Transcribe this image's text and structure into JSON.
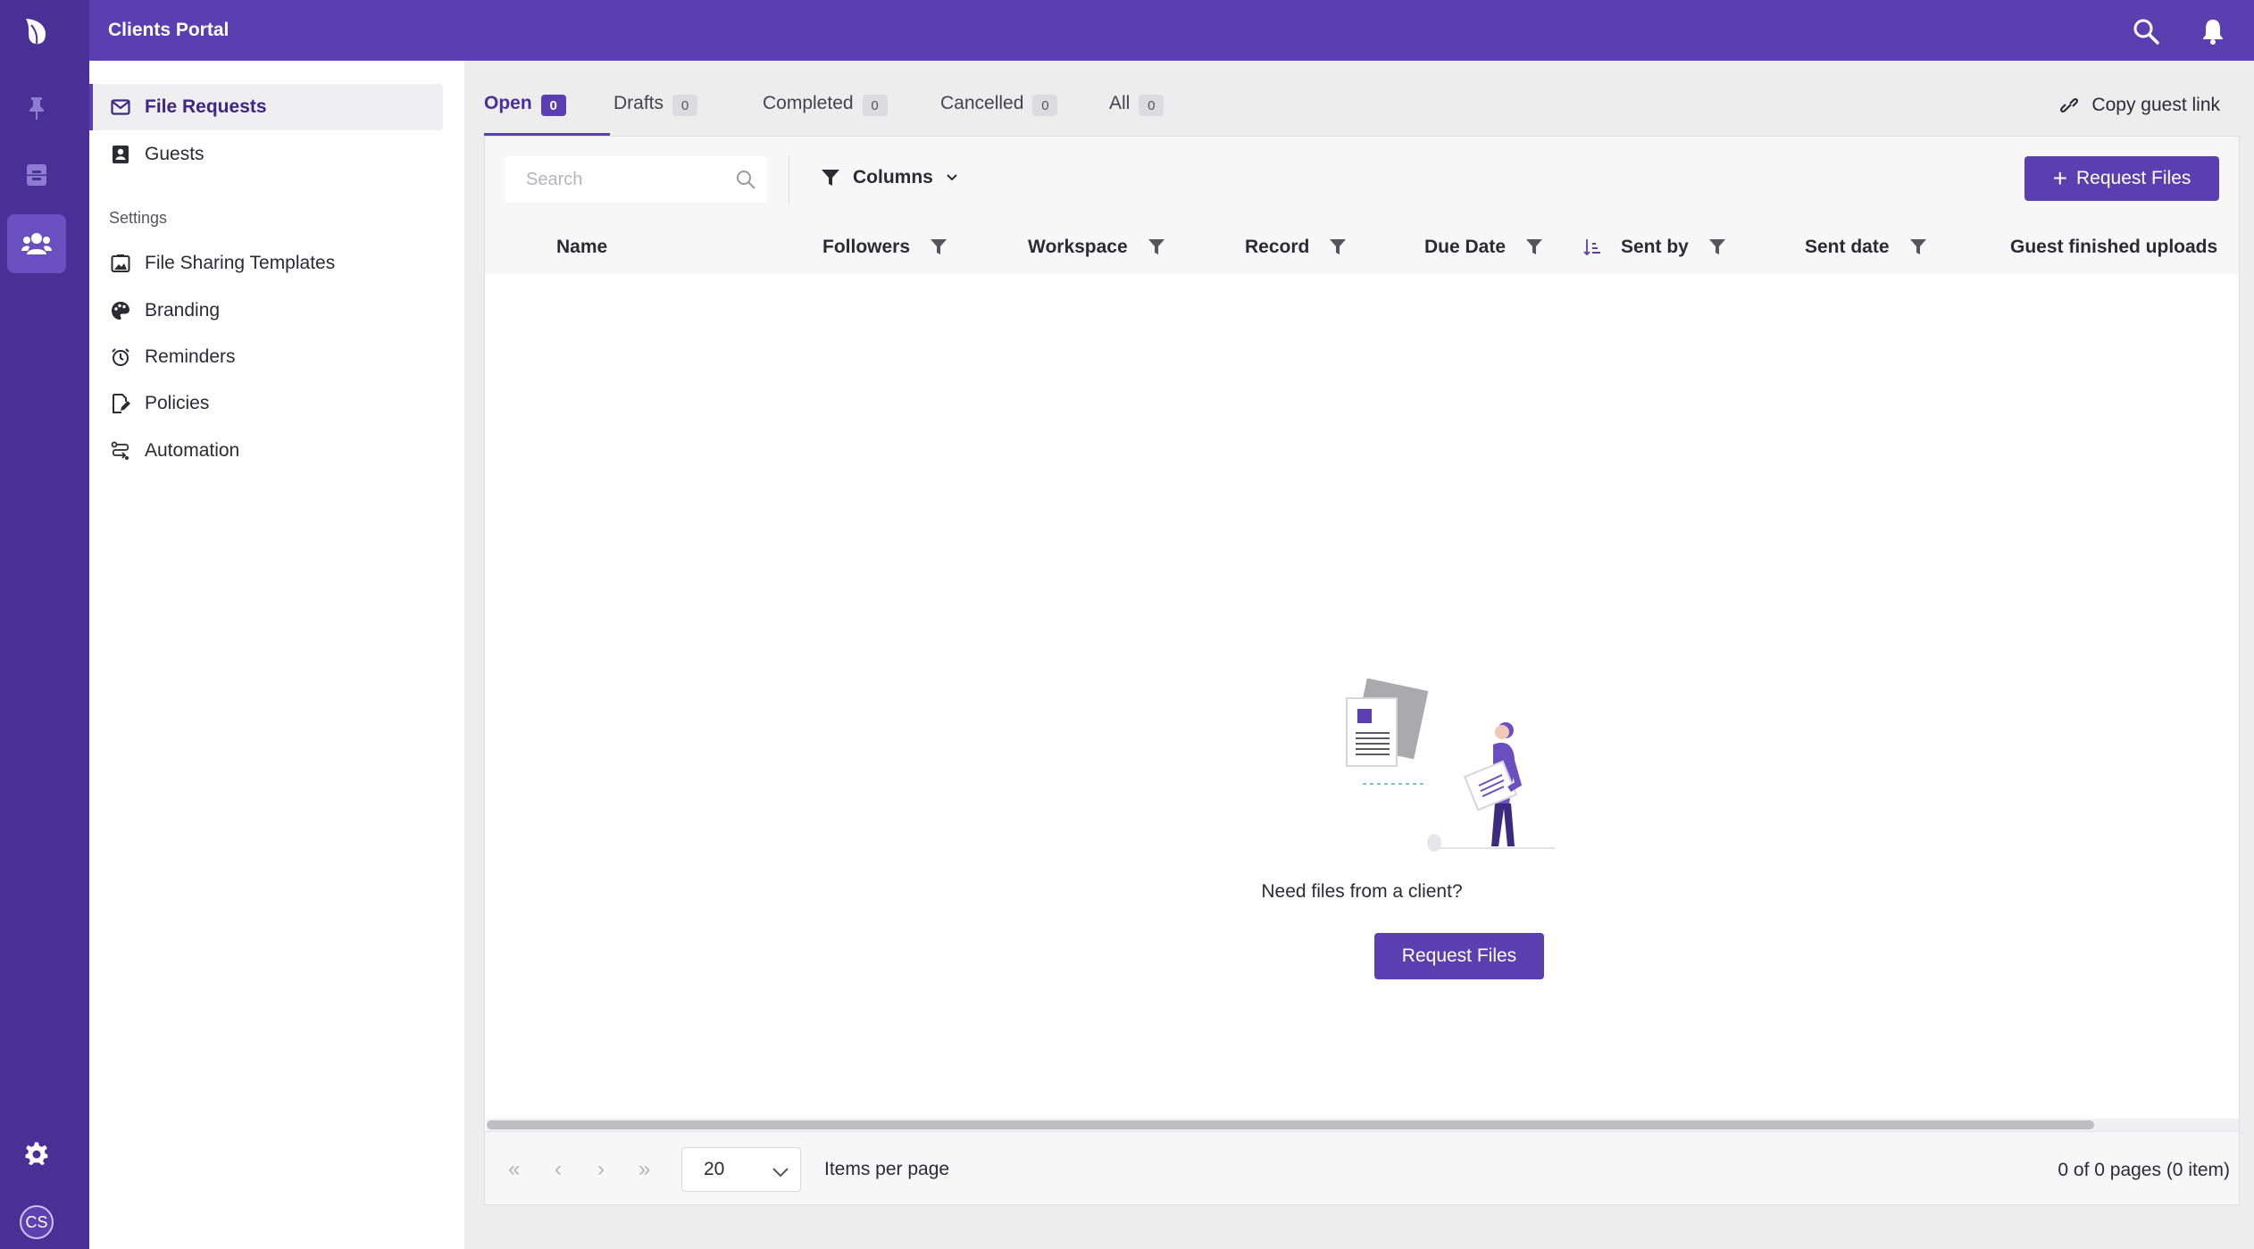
{
  "app": {
    "title": "Clients Portal",
    "accent": "#5b3fb1",
    "rail_color": "#4a2f97",
    "avatar_initials": "CS"
  },
  "rail": {
    "icons": [
      "leaf-logo-icon",
      "pin-icon",
      "cabinet-icon",
      "clients-icon",
      "gear-icon"
    ]
  },
  "topbar": {
    "icons": [
      "search-icon",
      "bell-icon"
    ]
  },
  "sidebar": {
    "items": [
      {
        "label": "File Requests",
        "icon": "mail-icon"
      },
      {
        "label": "Guests",
        "icon": "contact-card-icon"
      }
    ],
    "settings_label": "Settings",
    "settings_items": [
      {
        "label": "File Sharing Templates",
        "icon": "image-folder-icon"
      },
      {
        "label": "Branding",
        "icon": "palette-icon"
      },
      {
        "label": "Reminders",
        "icon": "alarm-icon"
      },
      {
        "label": "Policies",
        "icon": "document-edit-icon"
      },
      {
        "label": "Automation",
        "icon": "automation-icon"
      }
    ]
  },
  "tabs": [
    {
      "label": "Open",
      "count": "0"
    },
    {
      "label": "Drafts",
      "count": "0"
    },
    {
      "label": "Completed",
      "count": "0"
    },
    {
      "label": "Cancelled",
      "count": "0"
    },
    {
      "label": "All",
      "count": "0"
    }
  ],
  "copy_guest_link": "Copy guest link",
  "toolbar": {
    "search_placeholder": "Search",
    "columns_label": "Columns",
    "request_files_label": "Request Files"
  },
  "table": {
    "columns": [
      "Name",
      "Followers",
      "Workspace",
      "Record",
      "Due Date",
      "Sent by",
      "Sent date",
      "Guest finished uploads"
    ]
  },
  "empty_state": {
    "message": "Need files from a client?",
    "button_label": "Request Files"
  },
  "pager": {
    "page_size": "20",
    "items_per_page_label": "Items per page",
    "page_info": "0 of 0 pages (0 item)"
  }
}
